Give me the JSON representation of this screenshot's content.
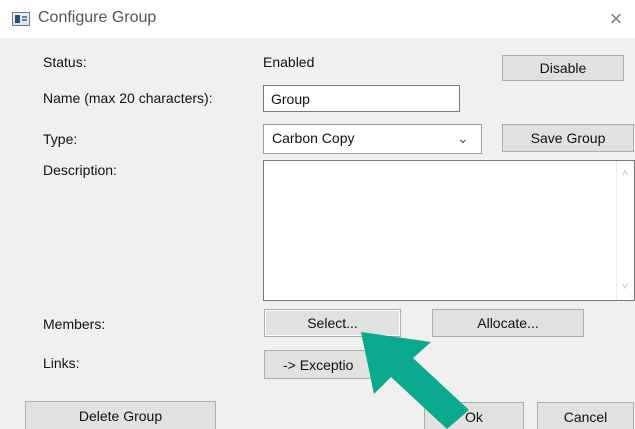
{
  "window": {
    "title": "Configure Group",
    "title_icon": "window-app-icon",
    "close_icon": "close-icon",
    "close_glyph": "×"
  },
  "fields": {
    "status_label": "Status:",
    "status_value": "Enabled",
    "name_label": "Name (max 20 characters):",
    "name_value": "Group",
    "type_label": "Type:",
    "type_value": "Carbon Copy",
    "description_label": "Description:",
    "members_label": "Members:",
    "links_label": "Links:"
  },
  "buttons": {
    "disable": "Disable",
    "save_group": "Save Group",
    "select": "Select...",
    "allocate": "Allocate...",
    "exception": "-> Exceptio",
    "delete_group": "Delete Group",
    "ok": "Ok",
    "cancel": "Cancel"
  },
  "icons": {
    "dropdown": "chevron-down-icon",
    "scroll_up": "scroll-up-icon",
    "scroll_down": "scroll-down-icon",
    "pointer_arrow": "pointer-arrow-icon"
  },
  "glyphs": {
    "chevron_down": "⌄",
    "scroll_up": "˄",
    "scroll_down": "˅"
  },
  "colors": {
    "dialog_background": "#f0f0f0",
    "button_background": "#e1e1e1",
    "arrow": "#0aa88d"
  }
}
